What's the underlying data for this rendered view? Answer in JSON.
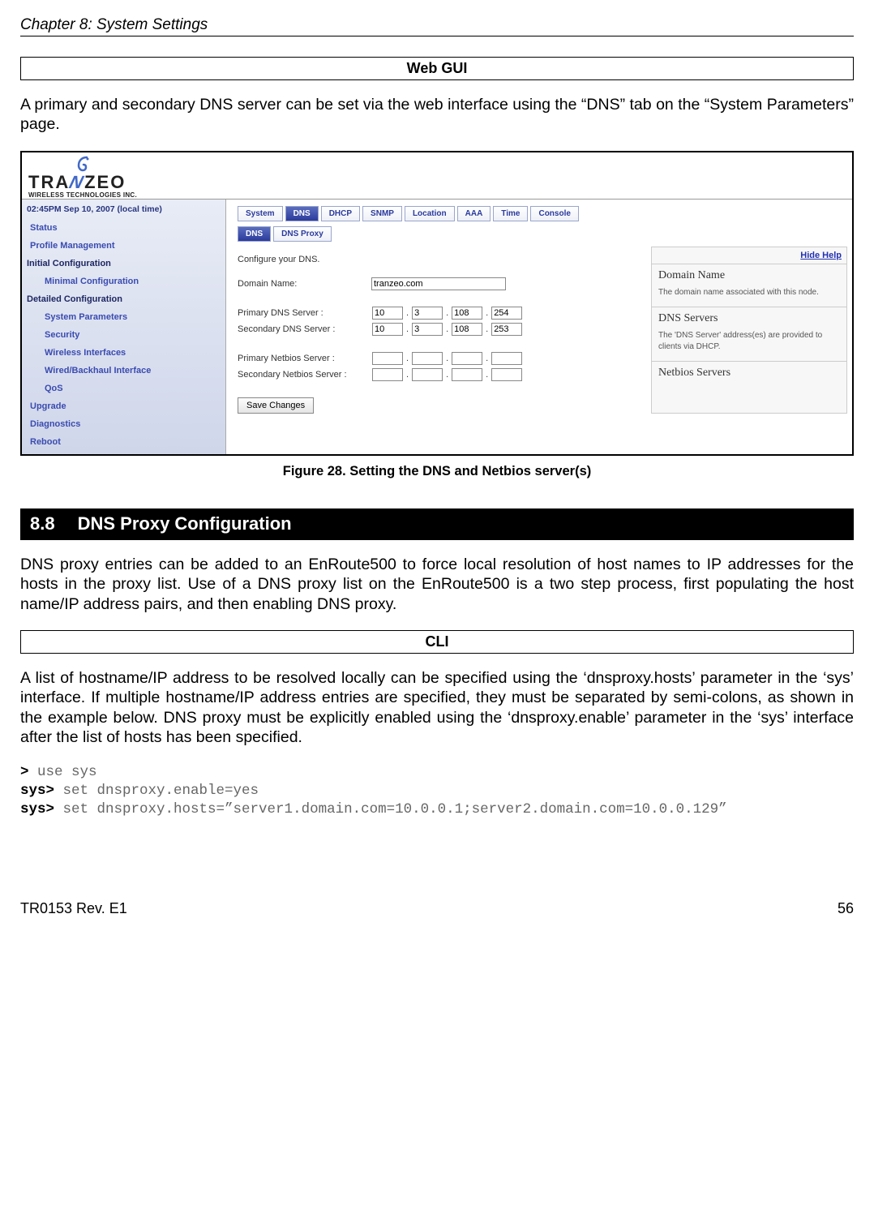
{
  "header": {
    "chapter": "Chapter 8: System Settings"
  },
  "webgui": {
    "box_label": "Web GUI",
    "intro": "A primary and secondary DNS server can be set via the web interface using the “DNS” tab on the “System Parameters” page."
  },
  "screenshot": {
    "logo": {
      "text_pre": "TRA",
      "text_n": "N",
      "text_post": "ZEO",
      "subline": "WIRELESS TECHNOLOGIES INC."
    },
    "time": "02:45PM Sep 10, 2007 (local time)",
    "nav": [
      {
        "label": "Status",
        "indent": false,
        "header": false
      },
      {
        "label": "Profile Management",
        "indent": false,
        "header": false
      },
      {
        "label": "Initial Configuration",
        "indent": false,
        "header": true
      },
      {
        "label": "Minimal Configuration",
        "indent": true,
        "header": false
      },
      {
        "label": "Detailed Configuration",
        "indent": false,
        "header": true
      },
      {
        "label": "System Parameters",
        "indent": true,
        "header": false
      },
      {
        "label": "Security",
        "indent": true,
        "header": false
      },
      {
        "label": "Wireless Interfaces",
        "indent": true,
        "header": false
      },
      {
        "label": "Wired/Backhaul Interface",
        "indent": true,
        "header": false
      },
      {
        "label": "QoS",
        "indent": true,
        "header": false
      },
      {
        "label": "Upgrade",
        "indent": false,
        "header": false
      },
      {
        "label": "Diagnostics",
        "indent": false,
        "header": false
      },
      {
        "label": "Reboot",
        "indent": false,
        "header": false
      }
    ],
    "tabs_main": [
      "System",
      "DNS",
      "DHCP",
      "SNMP",
      "Location",
      "AAA",
      "Time",
      "Console"
    ],
    "tabs_main_active": 1,
    "tabs_sub": [
      "DNS",
      "DNS Proxy"
    ],
    "tabs_sub_active": 0,
    "form": {
      "lead": "Configure your DNS.",
      "domain_name_label": "Domain Name:",
      "domain_name_value": "tranzeo.com",
      "primary_dns_label": "Primary DNS Server :",
      "primary_dns": [
        "10",
        "3",
        "108",
        "254"
      ],
      "secondary_dns_label": "Secondary DNS Server :",
      "secondary_dns": [
        "10",
        "3",
        "108",
        "253"
      ],
      "primary_nb_label": "Primary Netbios Server :",
      "primary_nb": [
        "",
        "",
        "",
        ""
      ],
      "secondary_nb_label": "Secondary Netbios Server :",
      "secondary_nb": [
        "",
        "",
        "",
        ""
      ],
      "save_label": "Save Changes"
    },
    "help": {
      "hide_label": "Hide Help",
      "s1_title": "Domain Name",
      "s1_body": "The domain name associated with this node.",
      "s2_title": "DNS Servers",
      "s2_body": "The 'DNS Server' address(es) are provided to clients via DHCP.",
      "s3_title": "Netbios Servers"
    }
  },
  "figure_caption": "Figure 28. Setting the DNS and Netbios server(s)",
  "section": {
    "num": "8.8",
    "title": "DNS Proxy Configuration",
    "para": "DNS proxy entries can be added to an EnRoute500 to force local resolution of host names to IP addresses for the hosts in the proxy list. Use of a DNS proxy list on the EnRoute500 is a two step process, first populating the host name/IP address pairs, and then enabling DNS proxy."
  },
  "cli": {
    "box_label": "CLI",
    "para": "A list of hostname/IP address to be resolved locally can be specified using the ‘dnsproxy.hosts’ parameter in the ‘sys’ interface. If multiple hostname/IP address entries are specified, they must be separated by semi-colons, as shown in the example below. DNS proxy must be explicitly enabled using the ‘dnsproxy.enable’ parameter in the ‘sys’ interface after the list of hosts has been specified.",
    "lines": {
      "p1": ">",
      "c1": " use sys",
      "p2": "sys>",
      "c2": " set dnsproxy.enable=yes",
      "p3": "sys>",
      "c3": " set dnsproxy.hosts=”server1.domain.com=10.0.0.1;server2.domain.com=10.0.0.129”"
    }
  },
  "footer": {
    "rev": "TR0153 Rev. E1",
    "page": "56"
  }
}
